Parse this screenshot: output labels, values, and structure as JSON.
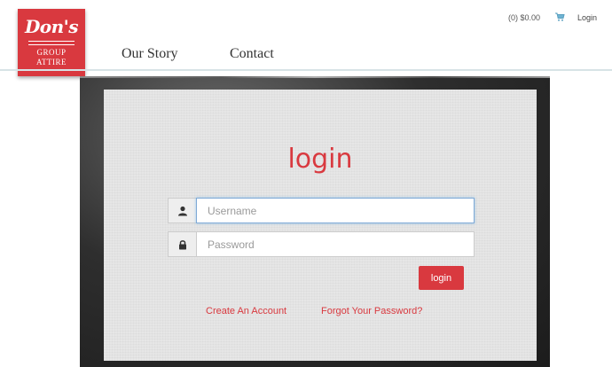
{
  "brand": {
    "logo_script": "Don's",
    "logo_line1": "GROUP",
    "logo_line2": "ATTIRE",
    "color": "#d9393f"
  },
  "nav": {
    "items": [
      {
        "label": "Our Story"
      },
      {
        "label": "Contact"
      }
    ]
  },
  "header_right": {
    "cart_summary": "(0) $0.00",
    "cart_icon": "cart-icon",
    "login_label": "Login"
  },
  "login_panel": {
    "title": "login",
    "username": {
      "placeholder": "Username",
      "icon": "user-icon",
      "value": ""
    },
    "password": {
      "placeholder": "Password",
      "icon": "lock-icon",
      "value": ""
    },
    "submit_label": "login",
    "create_account_label": "Create An Account",
    "forgot_password_label": "Forgot Your Password?"
  }
}
